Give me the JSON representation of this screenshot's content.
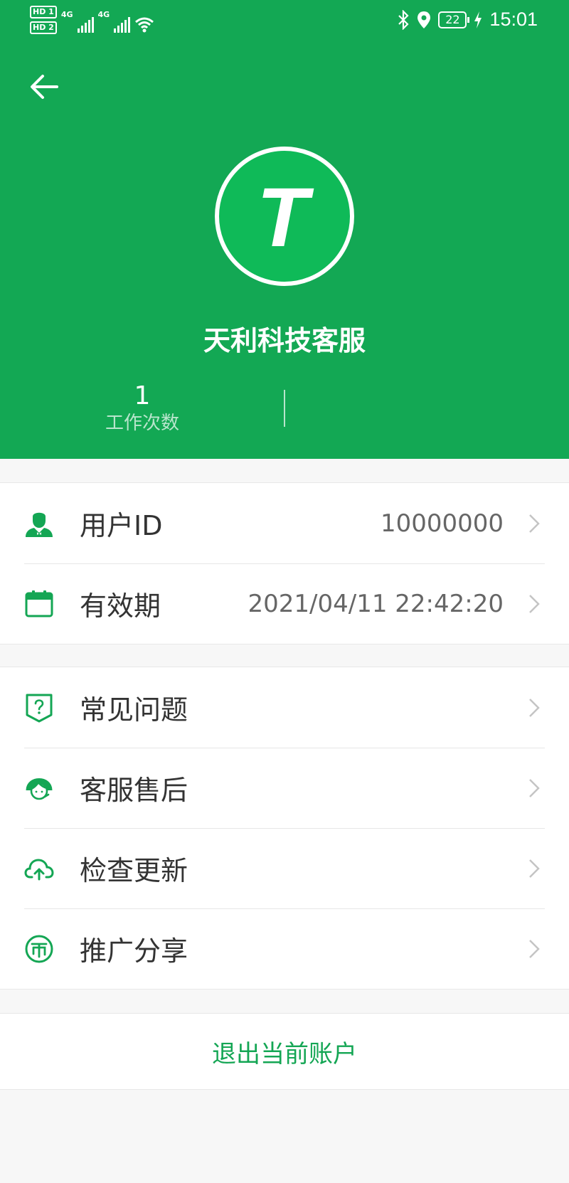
{
  "status_bar": {
    "sim1": "HD 1",
    "sim2": "HD 2",
    "network1": "4G",
    "network2": "4G",
    "battery": "22",
    "time": "15:01"
  },
  "header": {
    "avatar_letter": "T",
    "name": "天利科技客服",
    "stats": [
      {
        "value": "1",
        "label": "工作次数"
      }
    ]
  },
  "account": [
    {
      "icon": "user-icon",
      "label": "用户ID",
      "value": "10000000"
    },
    {
      "icon": "calendar-icon",
      "label": "有效期",
      "value": "2021/04/11 22:42:20"
    }
  ],
  "menu": [
    {
      "icon": "question-icon",
      "label": "常见问题"
    },
    {
      "icon": "customer-service-icon",
      "label": "客服售后"
    },
    {
      "icon": "cloud-upload-icon",
      "label": "检查更新"
    },
    {
      "icon": "coin-icon",
      "label": "推广分享"
    }
  ],
  "logout_label": "退出当前账户",
  "colors": {
    "brand": "#13a854",
    "icon": "#14a654",
    "background": "#f7f7f7"
  }
}
